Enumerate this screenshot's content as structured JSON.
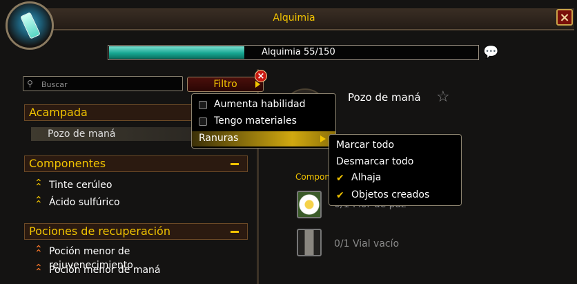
{
  "window": {
    "title": "Alquimia"
  },
  "progress": {
    "label": "Alquimia 55/150",
    "current": 55,
    "max": 150
  },
  "search": {
    "placeholder": "Buscar"
  },
  "filter": {
    "label": "Filtro"
  },
  "categories": [
    {
      "label": "Acampada",
      "recipes": [
        {
          "label": "Pozo de maná",
          "rank": "none"
        }
      ]
    },
    {
      "label": "Componentes",
      "recipes": [
        {
          "label": "Tinte cerúleo",
          "rank": "gold"
        },
        {
          "label": "Ácido sulfúrico",
          "rank": "gold"
        }
      ]
    },
    {
      "label": "Pociones de recuperación",
      "recipes": [
        {
          "label": "Poción menor de rejuvenecimiento",
          "rank": "orange"
        },
        {
          "label": "Poción menor de maná",
          "rank": "orange"
        }
      ]
    }
  ],
  "detail": {
    "name": "Pozo de maná",
    "components_label": "Compon",
    "reagents": [
      {
        "text": "0/1 Flor de paz",
        "icon": "daisy-icon"
      },
      {
        "text": "0/1 Vial vacío",
        "icon": "vial-icon"
      }
    ]
  },
  "filter_menu": {
    "items": [
      {
        "label": "Aumenta habilidad",
        "checked": false
      },
      {
        "label": "Tengo materiales",
        "checked": false
      },
      {
        "label": "Ranuras",
        "submenu": true
      }
    ]
  },
  "submenu": {
    "items": [
      {
        "label": "Marcar todo"
      },
      {
        "label": "Desmarcar todo"
      },
      {
        "label": "Alhaja",
        "checked": true
      },
      {
        "label": "Objetos creados",
        "checked": true
      }
    ]
  },
  "colors": {
    "accent": "#f2c400",
    "bar_fill": "#17a792",
    "bar_track": "#050505"
  }
}
